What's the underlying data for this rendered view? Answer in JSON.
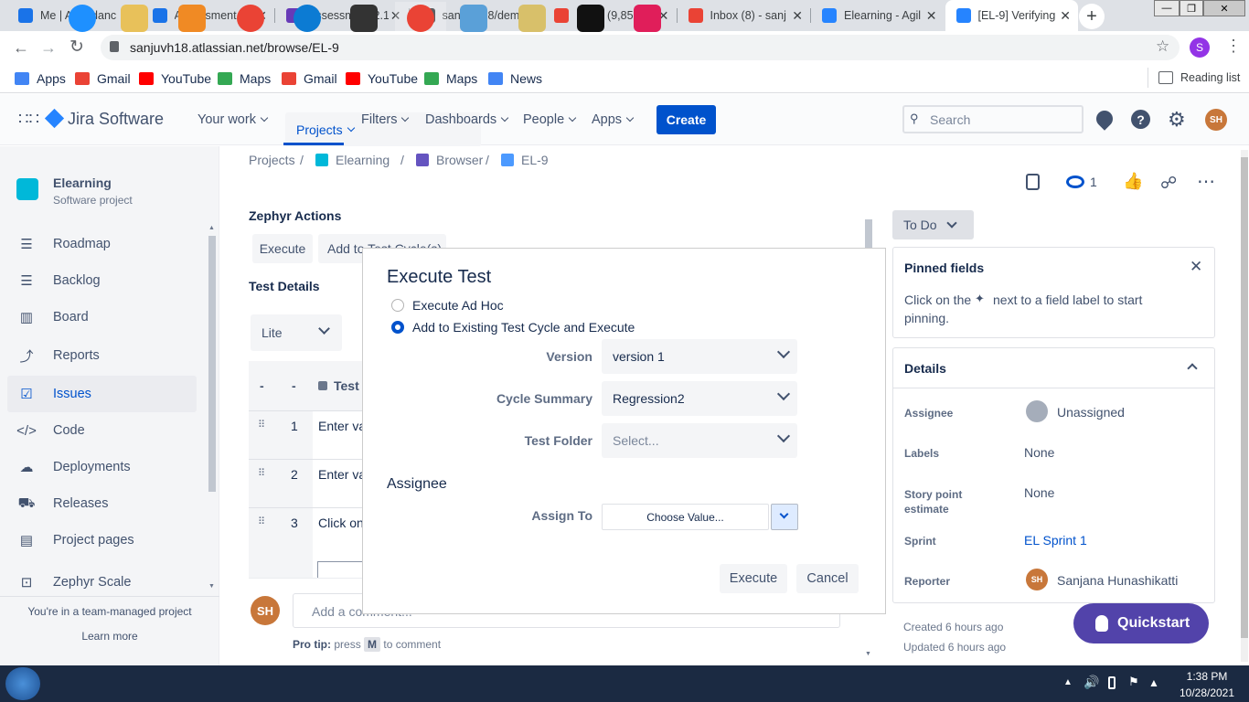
{
  "browser": {
    "tabs": [
      {
        "title": "Me | Attendanc",
        "icon": "k-icon",
        "color": "#1a73e8"
      },
      {
        "title": "Assessment 2.1",
        "icon": "classroom-icon",
        "color": "#1a73e8"
      },
      {
        "title": "Assessment 2.1",
        "icon": "forms-icon",
        "color": "#673ab7"
      },
      {
        "title": "sanjuvh18/dem",
        "icon": "github-icon",
        "color": "#24292e"
      },
      {
        "title": "Inbox (9,851) -",
        "icon": "gmail-icon",
        "color": "#ea4335"
      },
      {
        "title": "Inbox (8) - sanj",
        "icon": "gmail-icon",
        "color": "#ea4335"
      },
      {
        "title": "Elearning - Agil",
        "icon": "jira-icon",
        "color": "#2684ff"
      },
      {
        "title": "[EL-9] Verifying",
        "icon": "jira-icon",
        "color": "#2684ff"
      }
    ],
    "url": "sanjuvh18.atlassian.net/browse/EL-9",
    "profile_initial": "S",
    "bookmarks": [
      "Apps",
      "Gmail",
      "YouTube",
      "Maps",
      "Gmail",
      "YouTube",
      "Maps",
      "News"
    ],
    "reading_list": "Reading list"
  },
  "jira": {
    "logo": "Jira Software",
    "nav": [
      "Your work",
      "Projects",
      "Filters",
      "Dashboards",
      "People",
      "Apps"
    ],
    "create": "Create",
    "search_placeholder": "Search",
    "avatar": "SH"
  },
  "sidebar": {
    "project_name": "Elearning",
    "project_type": "Software project",
    "items": [
      {
        "label": "Roadmap",
        "icon": "roadmap-icon"
      },
      {
        "label": "Backlog",
        "icon": "backlog-icon"
      },
      {
        "label": "Board",
        "icon": "board-icon"
      },
      {
        "label": "Reports",
        "icon": "reports-icon"
      },
      {
        "label": "Issues",
        "icon": "issues-icon"
      },
      {
        "label": "Code",
        "icon": "code-icon"
      },
      {
        "label": "Deployments",
        "icon": "deployments-icon"
      },
      {
        "label": "Releases",
        "icon": "releases-icon"
      },
      {
        "label": "Project pages",
        "icon": "pages-icon"
      },
      {
        "label": "Zephyr Scale",
        "icon": "zephyr-icon"
      }
    ],
    "footer_text": "You're in a team-managed project",
    "learn_more": "Learn more"
  },
  "main": {
    "breadcrumb": [
      "Projects",
      "Elearning",
      "Browser",
      "EL-9"
    ],
    "zephyr_actions": "Zephyr Actions",
    "execute_btn": "Execute",
    "add_cycle_btn": "Add to Test Cycle(s)",
    "test_details": "Test Details",
    "lite": "Lite",
    "col1": "-",
    "col2": "-",
    "col_test": "Test",
    "rows": [
      {
        "num": "1",
        "text": "Enter va"
      },
      {
        "num": "2",
        "text": "Enter va"
      },
      {
        "num": "3",
        "text": "Click on"
      }
    ],
    "comment_avatar": "SH",
    "comment_placeholder": "Add a comment...",
    "protip_prefix": "Pro tip:",
    "protip_mid": "press",
    "protip_key": "M",
    "protip_suffix": "to comment"
  },
  "right": {
    "watch_count": "1",
    "status": "To Do",
    "pinned_title": "Pinned fields",
    "pinned_text_1": "Click on the",
    "pinned_text_2": "next to a field label to start",
    "pinned_text_3": "pinning.",
    "details": "Details",
    "fields": [
      {
        "label": "Assignee",
        "value": "Unassigned"
      },
      {
        "label": "Labels",
        "value": "None"
      },
      {
        "label": "Story point estimate",
        "value": "None"
      },
      {
        "label": "Sprint",
        "value": "EL Sprint 1"
      },
      {
        "label": "Reporter",
        "value": "Sanjana Hunashikatti"
      }
    ],
    "reporter_avatar": "SH",
    "created": "Created 6 hours ago",
    "updated": "Updated 6 hours ago",
    "quickstart": "Quickstart"
  },
  "modal": {
    "title": "Execute Test",
    "opt_adhoc": "Execute Ad Hoc",
    "opt_existing": "Add to Existing Test Cycle and Execute",
    "version_label": "Version",
    "version_value": "version 1",
    "cycle_label": "Cycle Summary",
    "cycle_value": "Regression2",
    "folder_label": "Test Folder",
    "folder_value": "Select...",
    "assignee_heading": "Assignee",
    "assign_label": "Assign To",
    "assign_value": "Choose Value...",
    "execute": "Execute",
    "cancel": "Cancel"
  },
  "taskbar": {
    "time": "1:38 PM",
    "date": "10/28/2021"
  }
}
